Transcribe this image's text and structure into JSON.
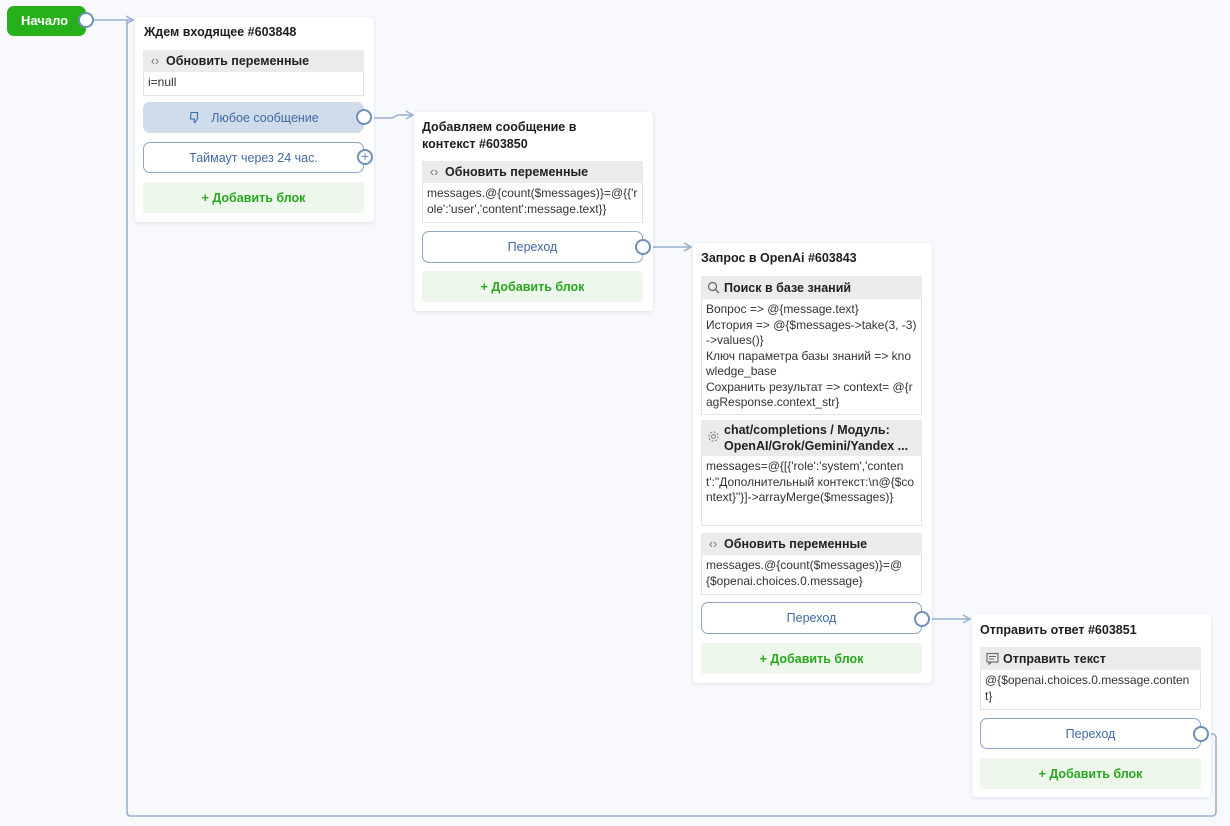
{
  "start": {
    "label": "Начало"
  },
  "nodes": {
    "wait": {
      "title": "Ждем входящее #603848",
      "update_vars": {
        "label": "Обновить переменные",
        "code": "i=null"
      },
      "any_message": "Любое сообщение",
      "timeout": "Таймаут через 24 час.",
      "add_block": "+ Добавить блок"
    },
    "add_context": {
      "title": "Добавляем сообщение в контекст #603850",
      "update_vars": {
        "label": "Обновить переменные",
        "code": "messages.@{count($messages)}=@{{'role':'user','content':message.text}}"
      },
      "transition": "Переход",
      "add_block": "+ Добавить блок"
    },
    "openai": {
      "title": "Запрос в OpenAi #603843",
      "kb_search": {
        "label": "Поиск в базе знаний",
        "body": "Вопрос => @{message.text}\nИстория => @{$messages->take(3, -3)->values()}\nКлюч параметра базы знаний => knowledge_base\nСохранить результат => context= @{ragResponse.context_str}"
      },
      "chat": {
        "label": "chat/completions / Модуль: OpenAI/Grok/Gemini/Yandex ...",
        "body": "messages=@{[{'role':'system','content':\"Дополнительный контекст:\\n@{$context}\"}]->arrayMerge($messages)}"
      },
      "update_vars": {
        "label": "Обновить переменные",
        "code": "messages.@{count($messages)}=@{$openai.choices.0.message}"
      },
      "transition": "Переход",
      "add_block": "+ Добавить блок"
    },
    "send": {
      "title": "Отправить ответ #603851",
      "send_text": {
        "label": "Отправить текст",
        "body": "@{$openai.choices.0.message.content}"
      },
      "transition": "Переход",
      "add_block": "+ Добавить блок"
    }
  },
  "colors": {
    "start": "#26b11a",
    "edge": "#9ab1cf",
    "port": "#6f8fb8",
    "add_text": "#28a81c",
    "link_text": "#3f6ba3"
  },
  "icons": {
    "code": "code-brackets-icon",
    "thumb": "thumb-down-icon",
    "search": "search-icon",
    "gear": "gear-icon",
    "message": "message-icon",
    "plus": "plus-icon"
  }
}
